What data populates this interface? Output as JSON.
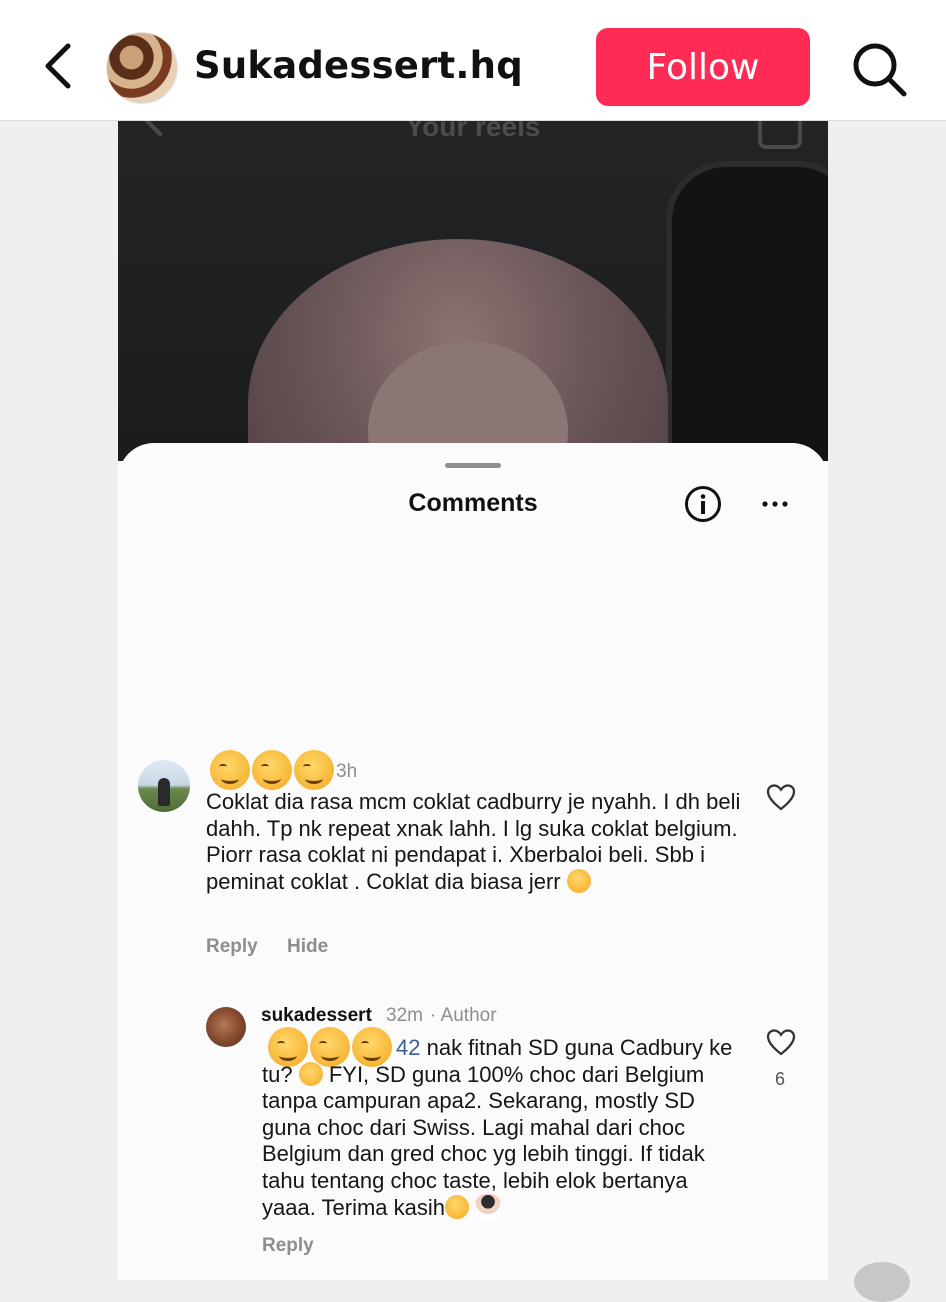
{
  "header": {
    "account_name": "Sukadessert.hq",
    "follow_label": "Follow"
  },
  "screenshot": {
    "reels_label": "Your reels",
    "sheet_title": "Comments",
    "comments": [
      {
        "time": "3h",
        "text": "Coklat dia rasa mcm coklat cadburry je nyahh. I dh beli dahh. Tp nk repeat xnak lahh. I lg suka coklat belgium. Piorr rasa coklat ni pendapat i. Xberbaloi beli. Sbb i peminat coklat . Coklat dia biasa jerr",
        "reply_label": "Reply",
        "hide_label": "Hide"
      },
      {
        "username": "sukadessert",
        "time": "32m",
        "badge": "· Author",
        "mention_suffix": "42",
        "text_a": " nak fitnah SD guna Cadbury ke tu?",
        "text_b": " FYI, SD guna 100% choc dari Belgium tanpa campuran apa2. Sekarang, mostly SD guna choc dari Swiss. Lagi mahal dari choc Belgium dan gred choc yg lebih tinggi. If tidak tahu tentang choc taste, lebih elok bertanya yaaa. Terima kasih",
        "reply_label": "Reply",
        "like_count": "6"
      }
    ]
  },
  "colors": {
    "follow_bg": "#fe2c55",
    "mention": "#3a5f94",
    "muted": "#8e8e8e"
  }
}
